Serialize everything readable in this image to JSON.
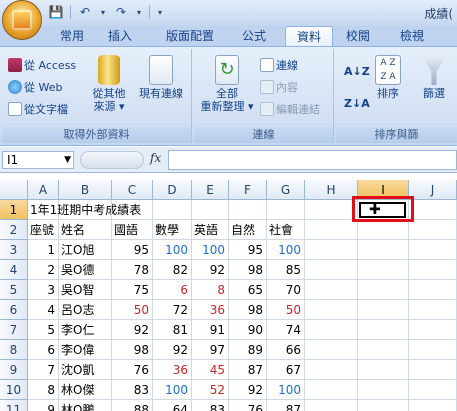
{
  "title_bar": {
    "text": "成績(",
    "qat_icons": [
      "save-icon",
      "undo-icon",
      "dropdown-icon",
      "redo-icon",
      "dropdown-icon",
      "customize-icon"
    ]
  },
  "tabs": [
    "常用",
    "插入",
    "版面配置",
    "公式",
    "資料",
    "校閱",
    "檢視"
  ],
  "active_tab": "資料",
  "ribbon": {
    "get_external": {
      "label": "取得外部資料",
      "from_access": "從 Access",
      "from_web": "從 Web",
      "from_text": "從文字檔",
      "from_other_1": "從其他",
      "from_other_2": "來源",
      "existing_1": "現有連線"
    },
    "connections": {
      "label": "連線",
      "refresh_1": "全部",
      "refresh_2": "重新整理",
      "connections": "連線",
      "properties": "內容",
      "edit_links": "編輯連結"
    },
    "sort": {
      "label": "排序與篩",
      "sort": "排序",
      "filter": "篩選"
    }
  },
  "formula_bar": {
    "name_box": "I1",
    "fx": "fx",
    "formula": ""
  },
  "columns": [
    "A",
    "B",
    "C",
    "D",
    "E",
    "F",
    "G",
    "H",
    "I",
    "J"
  ],
  "selected_column": "I",
  "rows": [
    {
      "n": "1",
      "cells": [
        "1年1班期中考成績表",
        "",
        "",
        "",
        "",
        "",
        "",
        ""
      ]
    },
    {
      "n": "2",
      "cells": [
        "座號",
        "姓名",
        "國語",
        "數學",
        "英語",
        "自然",
        "社會",
        ""
      ]
    },
    {
      "n": "3",
      "cells": [
        "1",
        "江O旭",
        "95",
        "100",
        "100",
        "95",
        "100",
        ""
      ]
    },
    {
      "n": "4",
      "cells": [
        "2",
        "吳O德",
        "78",
        "82",
        "92",
        "98",
        "85",
        ""
      ]
    },
    {
      "n": "5",
      "cells": [
        "3",
        "吳O智",
        "75",
        "6",
        "8",
        "65",
        "70",
        ""
      ]
    },
    {
      "n": "6",
      "cells": [
        "4",
        "呂O志",
        "50",
        "72",
        "36",
        "98",
        "50",
        ""
      ]
    },
    {
      "n": "7",
      "cells": [
        "5",
        "李O仁",
        "92",
        "81",
        "91",
        "90",
        "74",
        ""
      ]
    },
    {
      "n": "8",
      "cells": [
        "6",
        "李O偉",
        "98",
        "92",
        "97",
        "89",
        "66",
        ""
      ]
    },
    {
      "n": "9",
      "cells": [
        "7",
        "沈O凱",
        "76",
        "36",
        "45",
        "87",
        "67",
        ""
      ]
    },
    {
      "n": "10",
      "cells": [
        "8",
        "林O傑",
        "83",
        "100",
        "52",
        "92",
        "100",
        ""
      ]
    },
    {
      "n": "11",
      "cells": [
        "9",
        "林O鵬",
        "88",
        "64",
        "83",
        "76",
        "87",
        ""
      ]
    }
  ],
  "colors": {
    "score_100": "#1f6fd0",
    "score_fail": "#c0282c",
    "highlight": "#e0101a"
  }
}
